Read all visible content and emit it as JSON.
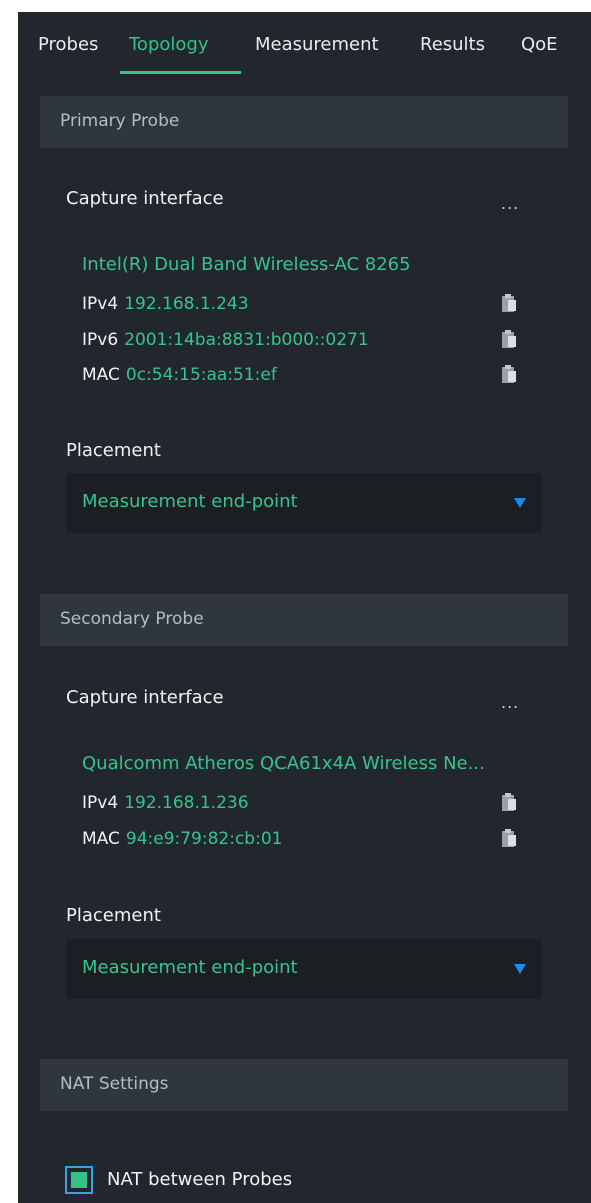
{
  "tabs": [
    {
      "label": "Probes"
    },
    {
      "label": "Topology",
      "active": true
    },
    {
      "label": "Measurement"
    },
    {
      "label": "Results"
    },
    {
      "label": "QoE"
    }
  ],
  "primary_probe": {
    "header": "Primary Probe",
    "capture_label": "Capture interface",
    "more_label": "...",
    "interface_name": "Intel(R) Dual Band Wireless-AC 8265",
    "addresses": [
      {
        "key": "IPv4",
        "value": "192.168.1.243"
      },
      {
        "key": "IPv6",
        "value": "2001:14ba:8831:b000::0271"
      },
      {
        "key": "MAC",
        "value": "0c:54:15:aa:51:ef"
      }
    ],
    "placement_label": "Placement",
    "placement_value": "Measurement end-point"
  },
  "secondary_probe": {
    "header": "Secondary Probe",
    "capture_label": "Capture interface",
    "more_label": "...",
    "interface_name": "Qualcomm Atheros QCA61x4A Wireless Ne...",
    "addresses": [
      {
        "key": "IPv4",
        "value": "192.168.1.236"
      },
      {
        "key": "MAC",
        "value": "94:e9:79:82:cb:01"
      }
    ],
    "placement_label": "Placement",
    "placement_value": "Measurement end-point"
  },
  "nat": {
    "header": "NAT Settings",
    "checkbox_label": "NAT between Probes",
    "checked": true
  },
  "colors": {
    "background": "#22272d",
    "section_header": "#2f3640",
    "accent_green": "#35c28a",
    "dropdown_caret": "#1e8ae8",
    "checkbox_border": "#3aa1e6"
  },
  "icons": {
    "copy": "clipboard-copy-icon",
    "dropdown": "caret-down-icon"
  }
}
